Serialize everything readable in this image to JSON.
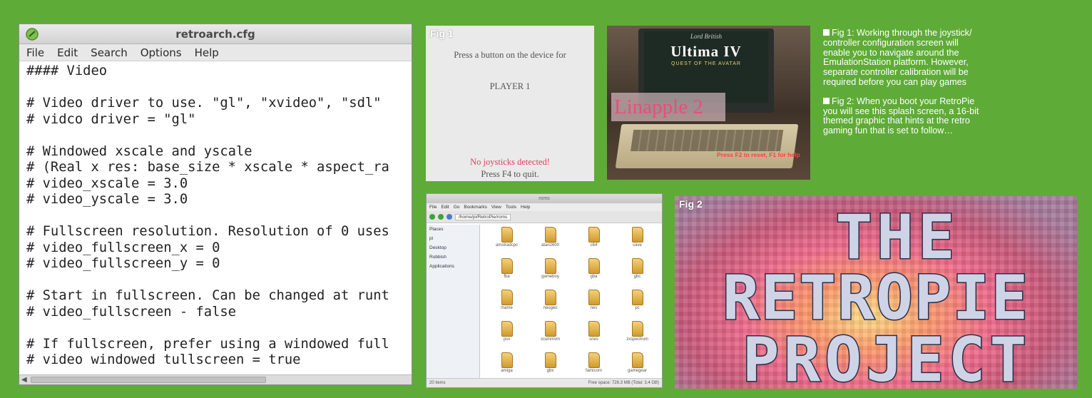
{
  "editor": {
    "title": "retroarch.cfg",
    "menu": [
      "File",
      "Edit",
      "Search",
      "Options",
      "Help"
    ],
    "code": "#### Video\n\n# Video driver to use. \"gl\", \"xvideo\", \"sdl\"\n# vidco driver = \"gl\"\n\n# Windowed xscale and yscale\n# (Real x res: base_size * xscale * aspect_ra\n# video_xscale = 3.0\n# video_yscale = 3.0\n\n# Fullscreen resolution. Resolution of 0 uses\n# video_fullscreen_x = 0\n# video_fullscreen_y = 0\n\n# Start in fullscreen. Can be changed at runt\n# video_fullscreen - false\n\n# If fullscreen, prefer using a windowed full\n# video windowed tullscreen = true"
  },
  "fig1": {
    "label": "Fig 1",
    "prompt": "Press a button on the device for",
    "player": "PLAYER 1",
    "warning": "No joysticks detected!",
    "quit": "Press F4 to quit."
  },
  "ultima": {
    "subtitle": "Lord British",
    "title": "Ultima IV",
    "quest": "QUEST OF THE AVATAR",
    "overlay": "Linapple 2",
    "hint": "Press F2 to reset, F1 for help"
  },
  "captions": [
    "Fig 1: Working through the joystick/ controller configuration screen will enable you to navigate around the EmulationStation platform. However, separate controller calibration will be required before you can play games",
    "Fig 2: When you boot your RetroPie you will see this splash screen, a 16-bit themed graphic that hints at the retro gaming fun that is set to follow…"
  ],
  "filemgr": {
    "title": "roms",
    "menu": [
      "File",
      "Edit",
      "Go",
      "Bookmarks",
      "View",
      "Tools",
      "Help"
    ],
    "path": "/home/pi/RetroPie/roms",
    "sidebar": [
      "Places",
      "pi",
      "Desktop",
      "Rubbish",
      "Applications"
    ],
    "folders": [
      "amstradcpc",
      "atari2600",
      "c64",
      "cave",
      "fba",
      "gameboy",
      "gba",
      "gbc",
      "mame",
      "neogeo",
      "nes",
      "pc",
      "psx",
      "scummvm",
      "snes",
      "zxspectrum",
      "amiga",
      "gbx",
      "famicom",
      "gamegear"
    ],
    "status_left": "20 items",
    "status_right": "Free space: 726.3 MB (Total: 3.4 GB)"
  },
  "fig2": {
    "label": "Fig 2",
    "lines": [
      "THE",
      "RETROPIE",
      "PROJECT"
    ]
  }
}
